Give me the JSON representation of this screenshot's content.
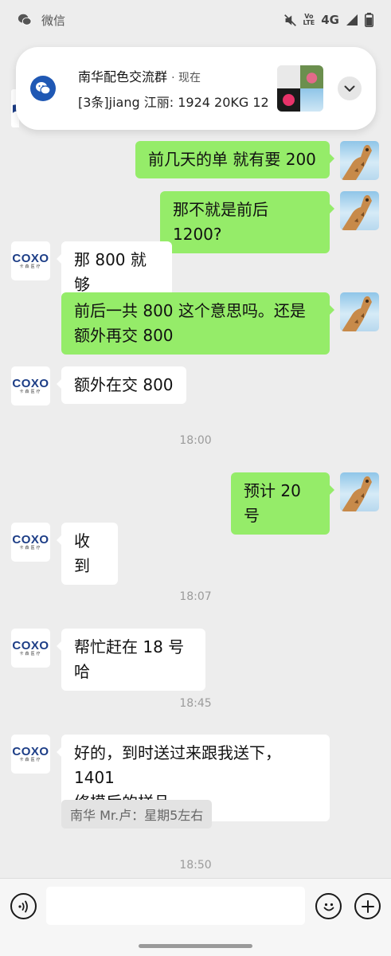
{
  "status_bar": {
    "app_name": "微信",
    "volte_top": "Vo",
    "volte_bottom": "LTE",
    "network": "4G"
  },
  "notification": {
    "group_name": "南华配色交流群",
    "time": "· 现在",
    "message": "[3条]jiang 江丽: 1924  20KG 12..."
  },
  "messages": [
    {
      "side": "out",
      "text": "前几天的单 就有要 200"
    },
    {
      "side": "out",
      "text": "那不就是前后1200?"
    },
    {
      "side": "in",
      "text": "那 800 就够"
    },
    {
      "side": "out",
      "line1": "前后一共 800 这个意思吗。还是",
      "line2": "额外再交 800"
    },
    {
      "side": "in",
      "text": "额外在交 800"
    },
    {
      "side": "out",
      "text": "预计 20 号"
    },
    {
      "side": "in",
      "text": "收到"
    },
    {
      "side": "in",
      "text": "帮忙赶在 18 号哈"
    },
    {
      "side": "in",
      "line1": "好的，到时送过来跟我送下，1401",
      "line2": "修模后的样品"
    }
  ],
  "timestamps": [
    "18:00",
    "18:07",
    "18:45",
    "18:50"
  ],
  "quote": "南华 Mr.卢：星期5左右",
  "avatar_brand": {
    "name": "COXO",
    "sub": "卡森医疗"
  },
  "input": {
    "value": ""
  },
  "colors": {
    "background": "#ededed",
    "bubble_out": "#95ec69",
    "bubble_in": "#ffffff",
    "brand": "#1c3d86"
  }
}
